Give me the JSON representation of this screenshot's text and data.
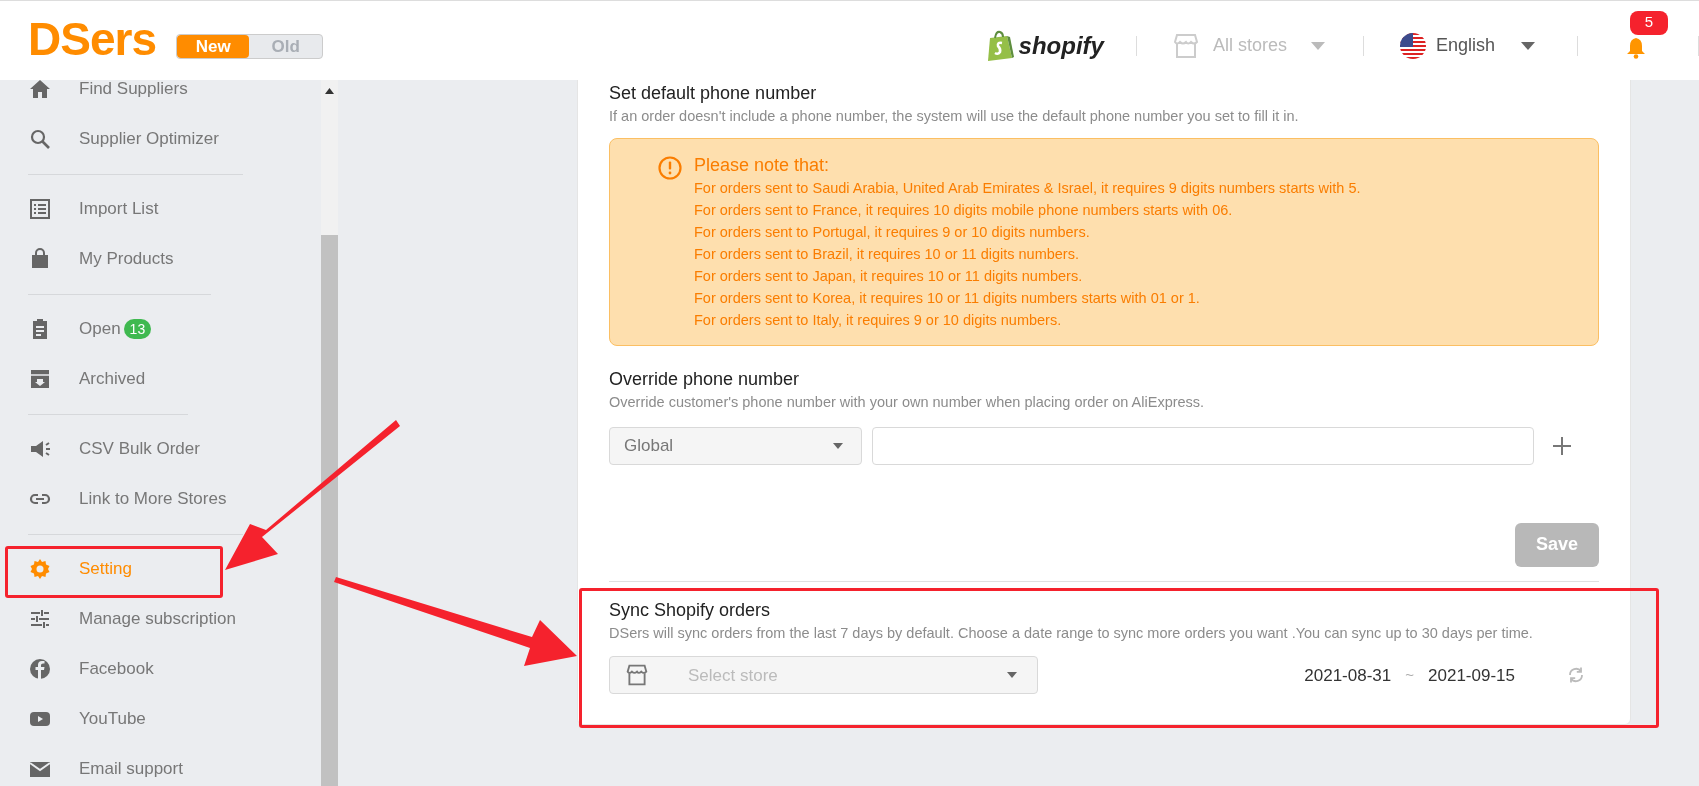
{
  "header": {
    "logo": "DSers",
    "version_toggle": [
      {
        "label": "New",
        "selected": true
      },
      {
        "label": "Old",
        "selected": false
      }
    ],
    "platform": "shopify",
    "store_selector": {
      "value": "All stores"
    },
    "language": {
      "value": "English"
    },
    "notifications": {
      "count": "5"
    }
  },
  "sidebar": {
    "groups": [
      [
        {
          "label": "Find Suppliers",
          "selected": false
        },
        {
          "label": "Supplier Optimizer",
          "selected": false
        }
      ],
      [
        {
          "label": "Import List",
          "selected": false
        },
        {
          "label": "My Products",
          "selected": false
        }
      ],
      [
        {
          "label": "Open",
          "selected": false,
          "badge": "13"
        },
        {
          "label": "Archived",
          "selected": false
        }
      ],
      [
        {
          "label": "CSV Bulk Order",
          "selected": false
        },
        {
          "label": "Link to More Stores",
          "selected": false
        }
      ],
      [
        {
          "label": "Setting",
          "selected": true
        },
        {
          "label": "Manage subscription",
          "selected": false
        },
        {
          "label": "Facebook",
          "selected": false
        },
        {
          "label": "YouTube",
          "selected": false
        },
        {
          "label": "Email support",
          "selected": false
        }
      ]
    ]
  },
  "default_phone": {
    "title": "Set default phone number",
    "description": "If an order doesn't include a phone number, the system will use the default phone number you set to fill it in.",
    "note": {
      "title": "Please note that:",
      "lines": [
        "For orders sent to Saudi Arabia, United Arab Emirates & Israel, it requires 9 digits numbers starts with 5.",
        "For orders sent to France, it requires 10 digits mobile phone numbers starts with 06.",
        "For orders sent to Portugal, it requires 9 or 10 digits numbers.",
        "For orders sent to Brazil, it requires 10 or 11 digits numbers.",
        "For orders sent to Japan, it requires 10 or 11 digits numbers.",
        "For orders sent to Korea, it requires 10 or 11 digits numbers starts with 01 or 1.",
        "For orders sent to Italy, it requires 9 or 10 digits numbers."
      ]
    }
  },
  "override_phone": {
    "title": "Override phone number",
    "description": "Override customer's phone number with your own number when placing order on AliExpress.",
    "country_select": {
      "value": "Global"
    }
  },
  "save_button": {
    "label": "Save",
    "disabled": true
  },
  "sync_orders": {
    "title": "Sync Shopify orders",
    "description": "DSers will sync orders from the last 7 days by default. Choose a date range to sync more orders you want .You can sync up to 30 days per time.",
    "store_select": {
      "placeholder": "Select store"
    },
    "start_date": "2021-08-31",
    "separator": "~",
    "end_date": "2021-09-15"
  }
}
